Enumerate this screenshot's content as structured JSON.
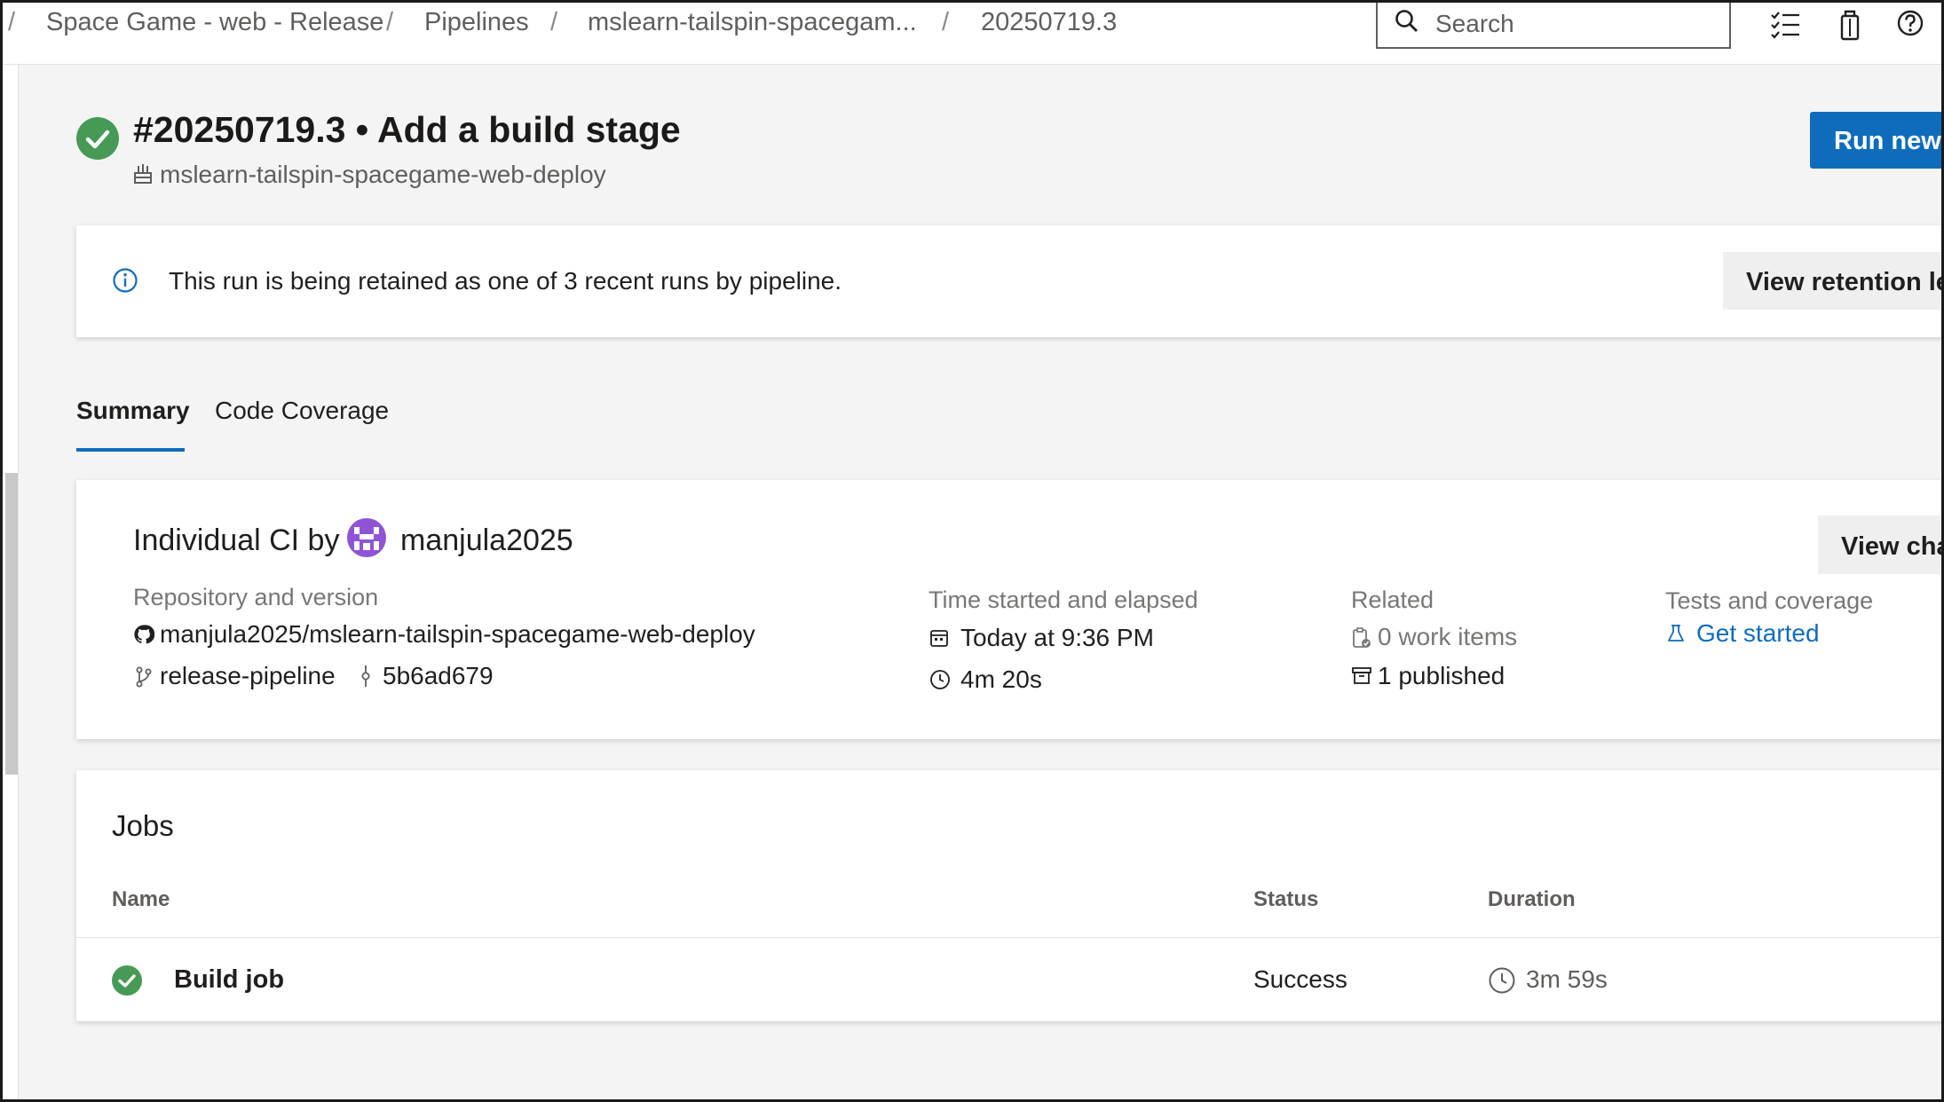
{
  "breadcrumb": {
    "project": "Space Game - web - Release",
    "section": "Pipelines",
    "pipeline": "mslearn-tailspin-spacegam...",
    "run": "20250719.3",
    "separator": "/"
  },
  "search": {
    "placeholder": "Search"
  },
  "run": {
    "title": "#20250719.3 • Add a build stage",
    "pipeline_name": "mslearn-tailspin-spacegame-web-deploy",
    "status": "succeeded",
    "run_new_label": "Run new"
  },
  "retention": {
    "message": "This run is being retained as one of 3 recent runs by pipeline.",
    "button_label": "View retention lea"
  },
  "tabs": [
    {
      "label": "Summary",
      "selected": true
    },
    {
      "label": "Code Coverage",
      "selected": false
    }
  ],
  "summary": {
    "trigger_prefix": "Individual CI by",
    "user": "manjula2025",
    "view_changes_label": "View cha",
    "repository": {
      "label": "Repository and version",
      "repo": "manjula2025/mslearn-tailspin-spacegame-web-deploy",
      "branch": "release-pipeline",
      "commit": "5b6ad679"
    },
    "time": {
      "label": "Time started and elapsed",
      "started": "Today at 9:36 PM",
      "elapsed": "4m 20s"
    },
    "related": {
      "label": "Related",
      "work_items": "0 work items",
      "published": "1 published"
    },
    "tests": {
      "label": "Tests and coverage",
      "link": "Get started"
    }
  },
  "jobs": {
    "title": "Jobs",
    "columns": {
      "name": "Name",
      "status": "Status",
      "duration": "Duration"
    },
    "rows": [
      {
        "name": "Build job",
        "status": "Success",
        "duration": "3m 59s"
      }
    ]
  },
  "colors": {
    "accent": "#0f6cbd",
    "success": "#479a55",
    "avatar": "#8f54d6"
  }
}
